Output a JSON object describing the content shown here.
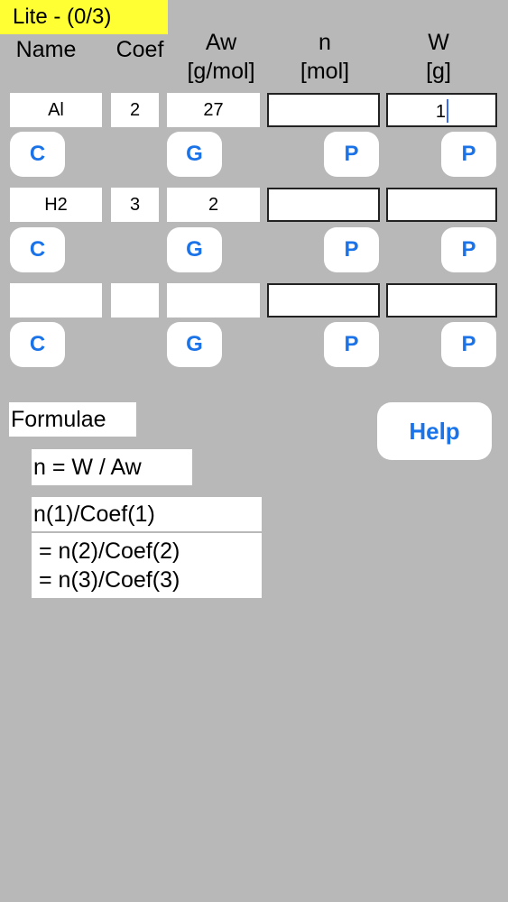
{
  "title": "Lite - (0/3)",
  "headers": {
    "name": "Name",
    "coef": "Coef",
    "aw": "Aw",
    "aw_unit": "[g/mol]",
    "n": "n",
    "n_unit": "[mol]",
    "w": "W",
    "w_unit": "[g]"
  },
  "rows": [
    {
      "name": "Al",
      "coef": "2",
      "aw": "27",
      "n": "",
      "w": "1"
    },
    {
      "name": "H2",
      "coef": "3",
      "aw": "2",
      "n": "",
      "w": ""
    },
    {
      "name": "",
      "coef": "",
      "aw": "",
      "n": "",
      "w": ""
    }
  ],
  "buttons": {
    "c": "C",
    "g": "G",
    "p": "P",
    "help": "Help"
  },
  "formulae": {
    "label": "Formulae",
    "formula1": "n = W / Aw",
    "formula2": "n(1)/Coef(1)",
    "formula3a": "= n(2)/Coef(2)",
    "formula3b": "= n(3)/Coef(3)"
  },
  "colors": {
    "background": "#b8b8b8",
    "title_badge": "#ffff33",
    "button_text": "#1a73e8"
  }
}
